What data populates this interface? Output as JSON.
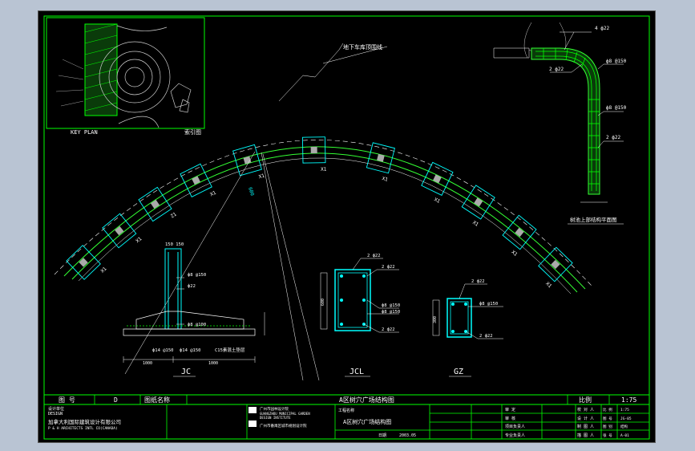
{
  "key_plan": {
    "label": "KEY PLAN",
    "label_cn": "索引图"
  },
  "main_title": "A区树穴广场结构图",
  "arc": {
    "leader_label": "地下车库顶围线",
    "detail_label": "X1",
    "alt_label": "Z1",
    "dim_label": "600"
  },
  "corner_detail": {
    "labels": [
      "4 ф22",
      "ф8 @150",
      "2 ф22",
      "ф8 @150",
      "2 ф22"
    ],
    "title": "树池上部结构平面图"
  },
  "jc": {
    "title": "JC",
    "labels": [
      "150 150",
      "ф8 @150",
      "ф22",
      "ф8 @100",
      "ф14 @150",
      "ф14 @150",
      "C15素混土垫层"
    ],
    "dims": [
      "1000",
      "1000"
    ]
  },
  "jcl": {
    "title": "JCL",
    "labels": [
      "2 ф22",
      "2 ф22",
      "ф8 @150",
      "ф8 @150",
      "2 ф22"
    ],
    "dim": "600"
  },
  "gz": {
    "title": "GZ",
    "labels": [
      "2 ф22",
      "ф8 @150",
      "2 ф22"
    ],
    "dim": "300"
  },
  "title_block": {
    "drawing_no_label": "图  号",
    "drawing_no_value": "D",
    "drawing_name_label": "图纸名称",
    "drawing_name_value": "A区树穴广场结构图",
    "scale_label": "比例",
    "scale_value": "1:75",
    "left_lines": [
      "设计单位",
      "DESIGN",
      "加拿大利国际建筑设计有限公司",
      "P & H  ARCHITECTS  INTL CO(CANADA)"
    ],
    "company_lines": [
      "广州市园林设计院",
      "GUANGZHOU MUNICIPAL GARDEN",
      "DESIGN INSTITUTE",
      "广州市番禺区城市规划设计院"
    ],
    "project_label": "工程名称",
    "sub_title": "A区树穴广场结构图",
    "date_label": "日期",
    "date_value": "2003.05",
    "mid_rows": [
      "审  定",
      "审  核",
      "项目负责人",
      "专业负责人"
    ],
    "right_rows": [
      "校 对 人",
      "设 计 人",
      "制 图 人",
      "描 图 人"
    ],
    "far_rows": [
      [
        "比 例",
        "1:75"
      ],
      [
        "图 号",
        "JG-05"
      ],
      [
        "图 别",
        "结构"
      ],
      [
        "张 号",
        "A-01"
      ]
    ]
  },
  "colors": {
    "frame": "#00ff00",
    "member": "#00ffff",
    "dim": "#ffffff",
    "fill": "#33ff33"
  }
}
